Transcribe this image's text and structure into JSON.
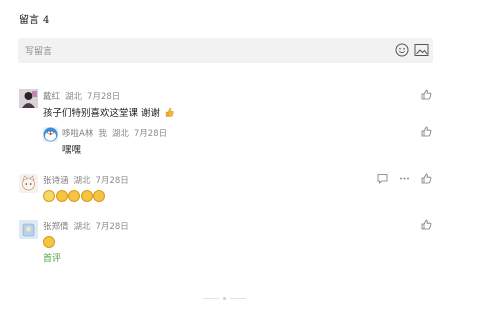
{
  "header": {
    "title": "留言",
    "count": "4"
  },
  "input": {
    "placeholder": "写留言",
    "emoji_icon": "smiley-icon",
    "image_icon": "image-icon"
  },
  "comments": [
    {
      "name": "戴红",
      "region": "湖北",
      "date": "7月28日",
      "text": "孩子们特别喜欢这堂课 谢谢",
      "reply": {
        "name": "哆啦A林",
        "tag": "我",
        "region": "湖北",
        "date": "7月28日",
        "text": "嘿嘿"
      }
    },
    {
      "name": "张诗涵",
      "region": "湖北",
      "date": "7月28日",
      "emoji_count": 5
    },
    {
      "name": "张郑倩",
      "region": "湖北",
      "date": "7月28日",
      "emoji_count": 1,
      "badge": "首评"
    }
  ],
  "colors": {
    "accent": "#4aa14a",
    "input_bg": "#f2f2f2",
    "meta": "#8c8c8c"
  }
}
